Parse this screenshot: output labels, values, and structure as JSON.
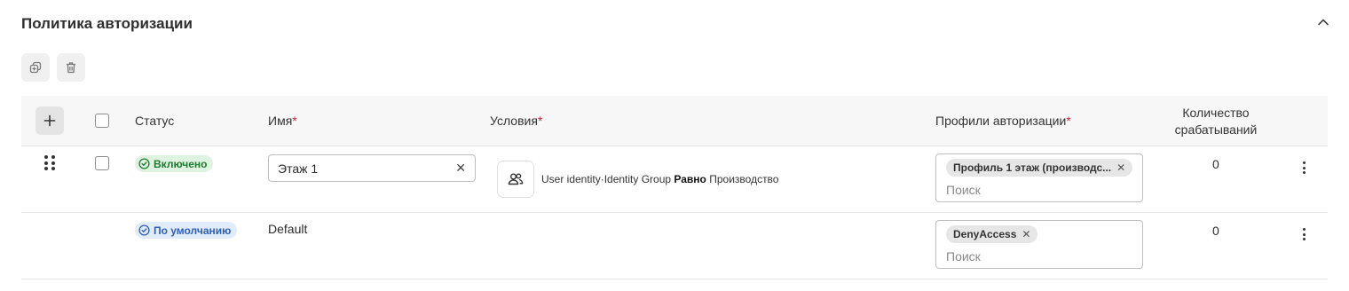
{
  "section": {
    "title": "Политика авторизации"
  },
  "table": {
    "headers": {
      "status": "Статус",
      "name": "Имя",
      "conditions": "Условия",
      "profiles": "Профили авторизации",
      "hits_line1": "Количество",
      "hits_line2": "срабатываний",
      "required_mark": "*"
    },
    "rows": [
      {
        "status": "Включено",
        "name": "Этаж 1",
        "condition": {
          "attribute": "User identity·Identity Group",
          "operator": "Равно",
          "value": "Производство"
        },
        "profile_chip": "Профиль 1 этаж (производс...",
        "profile_search_placeholder": "Поиск",
        "hits": "0"
      },
      {
        "status": "По умолчанию",
        "name": "Default",
        "profile_chip": "DenyAccess",
        "profile_search_placeholder": "Поиск",
        "hits": "0"
      }
    ]
  },
  "colors": {
    "enabled_badge_bg": "#dff3e1",
    "enabled_badge_text": "#1f7a32",
    "default_badge_bg": "#e1ecfb",
    "default_badge_text": "#2f5fb3",
    "required_mark": "#c0263c"
  },
  "icons": {
    "collapse": "chevron-up-icon",
    "duplicate": "duplicate-icon",
    "delete": "trash-icon",
    "add": "plus-icon",
    "status": "check-circle-icon",
    "condition": "users-icon",
    "row_menu": "more-vertical-icon",
    "drag": "drag-handle-icon",
    "clear": "close-icon"
  }
}
